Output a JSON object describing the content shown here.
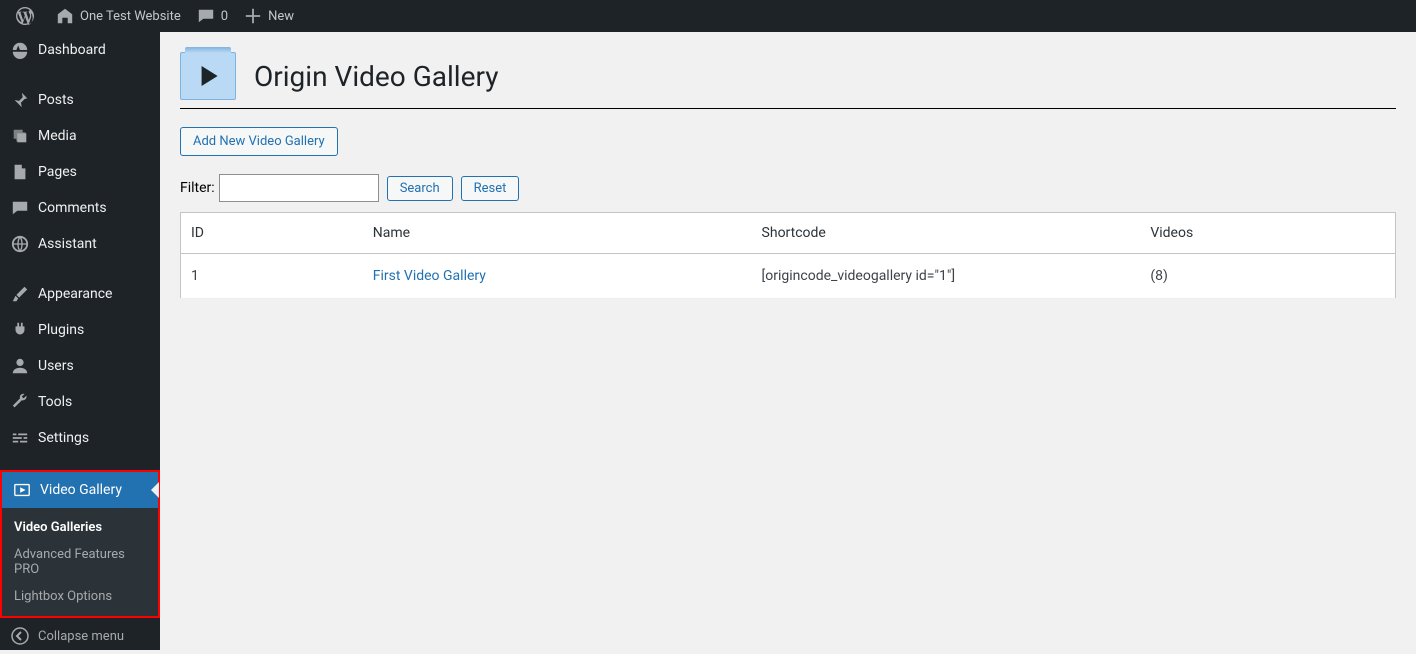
{
  "adminbar": {
    "site_name": "One Test Website",
    "comments_count": "0",
    "new_label": "New"
  },
  "sidebar": {
    "items": [
      {
        "label": "Dashboard"
      },
      {
        "label": "Posts"
      },
      {
        "label": "Media"
      },
      {
        "label": "Pages"
      },
      {
        "label": "Comments"
      },
      {
        "label": "Assistant"
      },
      {
        "label": "Appearance"
      },
      {
        "label": "Plugins"
      },
      {
        "label": "Users"
      },
      {
        "label": "Tools"
      },
      {
        "label": "Settings"
      },
      {
        "label": "Video Gallery"
      }
    ],
    "submenu": [
      {
        "label": "Video Galleries"
      },
      {
        "label": "Advanced Features PRO"
      },
      {
        "label": "Lightbox Options"
      }
    ],
    "collapse_label": "Collapse menu"
  },
  "page": {
    "title": "Origin Video Gallery",
    "add_new_label": "Add New Video Gallery",
    "filter_label": "Filter:",
    "search_label": "Search",
    "reset_label": "Reset",
    "columns": {
      "id": "ID",
      "name": "Name",
      "shortcode": "Shortcode",
      "videos": "Videos"
    },
    "rows": [
      {
        "id": "1",
        "name": "First Video Gallery",
        "shortcode": "[origincode_videogallery id=\"1\"]",
        "videos": "(8)"
      }
    ]
  }
}
